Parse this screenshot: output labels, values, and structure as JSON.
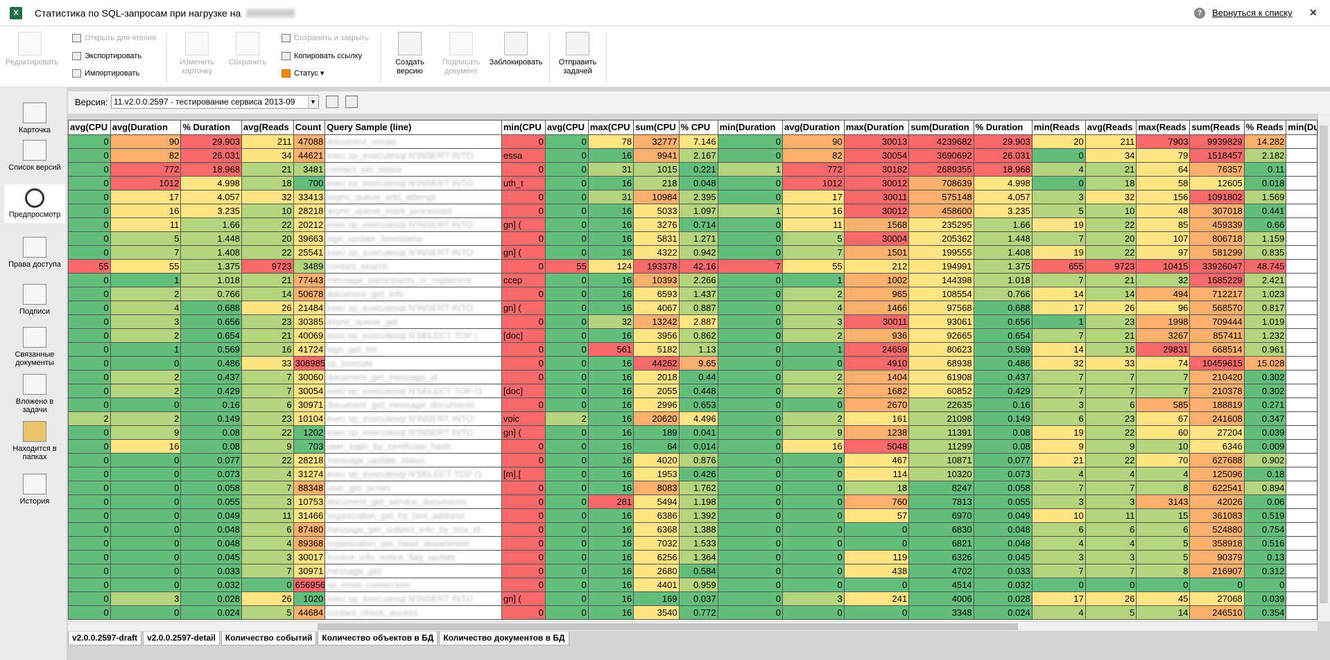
{
  "window": {
    "title": "Статистика по SQL-запросам при нагрузке на",
    "back_link": "Вернуться к списку"
  },
  "ribbon": {
    "edit": "Редактировать",
    "open_read": "Открыть для чтения",
    "export": "Экспортировать",
    "import": "Импортировать",
    "change_card": "Изменить карточку",
    "save": "Сохранить",
    "save_close": "Сохранить и закрыть",
    "copy_link": "Копировать ссылку",
    "status": "Статус",
    "create_version": "Создать версию",
    "sign_doc": "Подписать документ",
    "lock": "Заблокировать",
    "send_task": "Отправить задачей"
  },
  "sidebar": {
    "items": [
      {
        "label": "Карточка"
      },
      {
        "label": "Список версий"
      },
      {
        "label": "Предпросмотр"
      },
      {
        "label": "Права доступа"
      },
      {
        "label": "Подписи"
      },
      {
        "label": "Связанные документы"
      },
      {
        "label": "Вложено в задачи"
      },
      {
        "label": "Находится в папках"
      },
      {
        "label": "История"
      }
    ]
  },
  "version": {
    "label": "Версия:",
    "value": "11.v2.0.0.2597 - тестирование сервиса 2013-09"
  },
  "grid": {
    "headers": [
      "avg(CPU",
      "avg(Duration",
      "% Duration",
      "avg(Reads",
      "Count",
      "Query Sample (line)",
      "min(CPU",
      "avg(CPU",
      "max(CPU",
      "sum(CPU",
      "% CPU",
      "min(Duration",
      "avg(Duration",
      "max(Duration",
      "sum(Duration",
      "% Duration",
      "min(Reads",
      "avg(Reads",
      "max(Reads",
      "sum(Reads",
      "% Reads",
      "min(Dura"
    ],
    "rows": [
      [
        "0",
        "90",
        "29.903",
        "211",
        "47088",
        "document_create",
        "",
        "0",
        "0",
        "78",
        "32777",
        "7.146",
        "0",
        "90",
        "30013",
        "4239682",
        "29.903",
        "20",
        "211",
        "7903",
        "9939829",
        "14.282",
        ""
      ],
      [
        "0",
        "82",
        "26.031",
        "34",
        "44621",
        "exec sp_executesql N'INSERT INTO",
        "essa",
        "0",
        "0",
        "16",
        "9941",
        "2.167",
        "0",
        "82",
        "30054",
        "3690692",
        "26.031",
        "0",
        "34",
        "79",
        "1518457",
        "2.182",
        ""
      ],
      [
        "0",
        "772",
        "18.968",
        "21",
        "3481",
        "contact_set_status",
        "",
        "0",
        "0",
        "31",
        "1015",
        "0.221",
        "1",
        "772",
        "30182",
        "2689355",
        "18.968",
        "4",
        "21",
        "64",
        "76357",
        "0.11",
        ""
      ],
      [
        "0",
        "1012",
        "4.998",
        "18",
        "700",
        "exec sp_executesql N'INSERT INTO",
        "uth_t",
        "0",
        "0",
        "16",
        "218",
        "0.048",
        "0",
        "1012",
        "30012",
        "708639",
        "4.998",
        "0",
        "18",
        "58",
        "12605",
        "0.018",
        ""
      ],
      [
        "0",
        "17",
        "4.057",
        "32",
        "33413",
        "async_queue_add_attempt",
        "",
        "0",
        "0",
        "31",
        "10984",
        "2.395",
        "0",
        "17",
        "30011",
        "575148",
        "4.057",
        "3",
        "32",
        "156",
        "1091802",
        "1.569",
        ""
      ],
      [
        "0",
        "16",
        "3.235",
        "10",
        "28218",
        "async_queue_mark_processed",
        "",
        "0",
        "0",
        "16",
        "5033",
        "1.097",
        "1",
        "16",
        "30012",
        "458600",
        "3.235",
        "5",
        "10",
        "48",
        "307018",
        "0.441",
        ""
      ],
      [
        "0",
        "11",
        "1.66",
        "22",
        "20212",
        "exec sp_executesql N'INSERT INTO",
        "gn] (",
        "0",
        "0",
        "16",
        "3276",
        "0.714",
        "0",
        "11",
        "1568",
        "235295",
        "1.66",
        "19",
        "22",
        "85",
        "459339",
        "0.66",
        ""
      ],
      [
        "0",
        "5",
        "1.448",
        "20",
        "39663",
        "sign_update_timestamp",
        "",
        "0",
        "0",
        "16",
        "5831",
        "1.271",
        "0",
        "5",
        "30004",
        "205362",
        "1.448",
        "7",
        "20",
        "107",
        "806718",
        "1.159",
        ""
      ],
      [
        "0",
        "7",
        "1.408",
        "22",
        "25541",
        "exec sp_executesql N'INSERT INTO",
        "gn] (",
        "0",
        "0",
        "16",
        "4322",
        "0.942",
        "0",
        "7",
        "1501",
        "199555",
        "1.408",
        "19",
        "22",
        "97",
        "581299",
        "0.835",
        ""
      ],
      [
        "55",
        "55",
        "1.375",
        "9723",
        "3489",
        "contact_search",
        "",
        "0",
        "55",
        "124",
        "193378",
        "42.16",
        "7",
        "55",
        "212",
        "194991",
        "1.375",
        "655",
        "9723",
        "10415",
        "33926047",
        "48.745",
        ""
      ],
      [
        "0",
        "1",
        "1.018",
        "21",
        "77443",
        "message_participants_in_reglament",
        "ccep",
        "0",
        "0",
        "16",
        "10393",
        "2.266",
        "0",
        "1",
        "1002",
        "144398",
        "1.018",
        "7",
        "21",
        "32",
        "1685229",
        "2.421",
        ""
      ],
      [
        "0",
        "2",
        "0.766",
        "14",
        "50678",
        "document_get_info",
        "",
        "0",
        "0",
        "16",
        "6593",
        "1.437",
        "0",
        "2",
        "965",
        "108554",
        "0.766",
        "14",
        "14",
        "494",
        "712217",
        "1.023",
        ""
      ],
      [
        "0",
        "4",
        "0.688",
        "26",
        "21484",
        "exec sp_executesql N'INSERT INTO",
        "gn] (",
        "0",
        "0",
        "16",
        "4067",
        "0.887",
        "0",
        "4",
        "1466",
        "97568",
        "0.688",
        "17",
        "26",
        "96",
        "568570",
        "0.817",
        ""
      ],
      [
        "0",
        "3",
        "0.656",
        "23",
        "30385",
        "async_queue_get",
        "",
        "0",
        "0",
        "32",
        "13242",
        "2.887",
        "0",
        "3",
        "30011",
        "93061",
        "0.656",
        "1",
        "23",
        "1998",
        "709444",
        "1.019",
        ""
      ],
      [
        "0",
        "2",
        "0.654",
        "21",
        "40069",
        "exec sp_executesql N'SELECT TOP (",
        "[doc]",
        "0",
        "0",
        "16",
        "3956",
        "0.862",
        "0",
        "2",
        "936",
        "92665",
        "0.654",
        "7",
        "21",
        "3267",
        "857411",
        "1.232",
        ""
      ],
      [
        "0",
        "1",
        "0.569",
        "16",
        "41724",
        "sign_get_list",
        "",
        "0",
        "0",
        "561",
        "5182",
        "1.13",
        "0",
        "1",
        "24659",
        "80623",
        "0.569",
        "14",
        "16",
        "29831",
        "668514",
        "0.961",
        ""
      ],
      [
        "0",
        "0",
        "0.486",
        "33",
        "308985",
        "sp_execute",
        "",
        "0",
        "0",
        "16",
        "44262",
        "9.65",
        "0",
        "0",
        "4910",
        "68938",
        "0.486",
        "32",
        "33",
        "74",
        "10459615",
        "15.028",
        ""
      ],
      [
        "0",
        "2",
        "0.437",
        "7",
        "30060",
        "document_get_message_id",
        "",
        "0",
        "0",
        "16",
        "2018",
        "0.44",
        "0",
        "2",
        "1404",
        "61908",
        "0.437",
        "7",
        "7",
        "7",
        "210420",
        "0.302",
        ""
      ],
      [
        "0",
        "2",
        "0.429",
        "7",
        "30054",
        "exec sp_executesql N'SELECT TOP (1",
        "[doc]",
        "0",
        "0",
        "16",
        "2055",
        "0.448",
        "0",
        "2",
        "1682",
        "60852",
        "0.429",
        "7",
        "7",
        "7",
        "210378",
        "0.302",
        ""
      ],
      [
        "0",
        "0",
        "0.16",
        "6",
        "30971",
        "document_get_message_documents",
        "",
        "0",
        "0",
        "16",
        "2996",
        "0.653",
        "0",
        "0",
        "2670",
        "22635",
        "0.16",
        "3",
        "6",
        "585",
        "188819",
        "0.271",
        ""
      ],
      [
        "2",
        "2",
        "0.149",
        "23",
        "10104",
        "exec sp_executesql N'INSERT INTO",
        "voic",
        "0",
        "2",
        "16",
        "20620",
        "4.496",
        "0",
        "2",
        "161",
        "21098",
        "0.149",
        "6",
        "23",
        "67",
        "241608",
        "0.347",
        ""
      ],
      [
        "0",
        "9",
        "0.08",
        "22",
        "1202",
        "exec sp_executesql N'INSERT INTO",
        "gn] (",
        "0",
        "0",
        "16",
        "189",
        "0.041",
        "0",
        "9",
        "1238",
        "11391",
        "0.08",
        "19",
        "22",
        "60",
        "27204",
        "0.039",
        ""
      ],
      [
        "0",
        "16",
        "0.08",
        "9",
        "703",
        "user_login_by_certificate_hash",
        "",
        "0",
        "0",
        "16",
        "64",
        "0.014",
        "0",
        "16",
        "5048",
        "11299",
        "0.08",
        "9",
        "9",
        "10",
        "6346",
        "0.009",
        ""
      ],
      [
        "0",
        "0",
        "0.077",
        "22",
        "28218",
        "message_update_status",
        "",
        "0",
        "0",
        "16",
        "4020",
        "0.876",
        "0",
        "0",
        "467",
        "10871",
        "0.077",
        "21",
        "22",
        "70",
        "627688",
        "0.902",
        ""
      ],
      [
        "0",
        "0",
        "0.073",
        "4",
        "31274",
        "exec sp_executesql N'SELECT TOP (1",
        "[m].[",
        "0",
        "0",
        "16",
        "1953",
        "0.426",
        "0",
        "0",
        "114",
        "10320",
        "0.073",
        "4",
        "4",
        "4",
        "125096",
        "0.18",
        ""
      ],
      [
        "0",
        "0",
        "0.058",
        "7",
        "88348",
        "user_get_boxes",
        "",
        "0",
        "0",
        "16",
        "8083",
        "1.762",
        "0",
        "0",
        "18",
        "8247",
        "0.058",
        "7",
        "7",
        "8",
        "622541",
        "0.894",
        ""
      ],
      [
        "0",
        "0",
        "0.055",
        "3",
        "10753",
        "document_get_service_documents",
        "",
        "0",
        "0",
        "281",
        "5494",
        "1.198",
        "0",
        "0",
        "760",
        "7813",
        "0.055",
        "3",
        "3",
        "3143",
        "42026",
        "0.06",
        ""
      ],
      [
        "0",
        "0",
        "0.049",
        "11",
        "31466",
        "organization_get_by_box_address",
        "",
        "0",
        "0",
        "16",
        "6386",
        "1.392",
        "0",
        "0",
        "57",
        "6970",
        "0.049",
        "10",
        "11",
        "15",
        "361083",
        "0.519",
        ""
      ],
      [
        "0",
        "0",
        "0.048",
        "6",
        "87480",
        "message_get_subject_info_by_box_id",
        "",
        "0",
        "0",
        "16",
        "6368",
        "1.388",
        "0",
        "0",
        "0",
        "6830",
        "0.048",
        "6",
        "6",
        "6",
        "524880",
        "0.754",
        ""
      ],
      [
        "0",
        "0",
        "0.048",
        "4",
        "89368",
        "organization_get_head_department",
        "",
        "0",
        "0",
        "16",
        "7032",
        "1.533",
        "0",
        "0",
        "0",
        "6821",
        "0.048",
        "4",
        "4",
        "5",
        "358918",
        "0.516",
        ""
      ],
      [
        "0",
        "0",
        "0.045",
        "3",
        "30017",
        "invoice_info_notice_flag_update",
        "",
        "0",
        "0",
        "16",
        "6256",
        "1.364",
        "0",
        "0",
        "119",
        "6326",
        "0.045",
        "3",
        "3",
        "5",
        "90379",
        "0.13",
        ""
      ],
      [
        "0",
        "0",
        "0.033",
        "7",
        "30971",
        "message_get",
        "",
        "0",
        "0",
        "16",
        "2680",
        "0.584",
        "0",
        "0",
        "438",
        "4702",
        "0.033",
        "7",
        "7",
        "8",
        "216907",
        "0.312",
        ""
      ],
      [
        "0",
        "0",
        "0.032",
        "0",
        "656956",
        "sp_reset_connection",
        "",
        "0",
        "0",
        "16",
        "4401",
        "0.959",
        "0",
        "0",
        "0",
        "4514",
        "0.032",
        "0",
        "0",
        "0",
        "0",
        "0",
        ""
      ],
      [
        "0",
        "3",
        "0.028",
        "26",
        "1020",
        "exec sp_executesql N'INSERT INTO",
        "gn] (",
        "0",
        "0",
        "16",
        "169",
        "0.037",
        "0",
        "3",
        "241",
        "4006",
        "0.028",
        "17",
        "26",
        "45",
        "27068",
        "0.039",
        ""
      ],
      [
        "0",
        "0",
        "0.024",
        "5",
        "44684",
        "contact_check_access",
        "",
        "0",
        "0",
        "16",
        "3540",
        "0.772",
        "0",
        "0",
        "0",
        "3348",
        "0.024",
        "4",
        "5",
        "14",
        "246510",
        "0.354",
        ""
      ]
    ]
  },
  "sheet_tabs": [
    "v2.0.0.2597-draft",
    "v2.0.0.2597-detail",
    "Количество событий",
    "Количество объектов в БД",
    "Количество документов в БД"
  ],
  "colors": {
    "green": "#63be7b",
    "lightgreen": "#b4d57e",
    "yellow": "#ffe484",
    "orange": "#fbb06e",
    "red": "#f8696b"
  }
}
